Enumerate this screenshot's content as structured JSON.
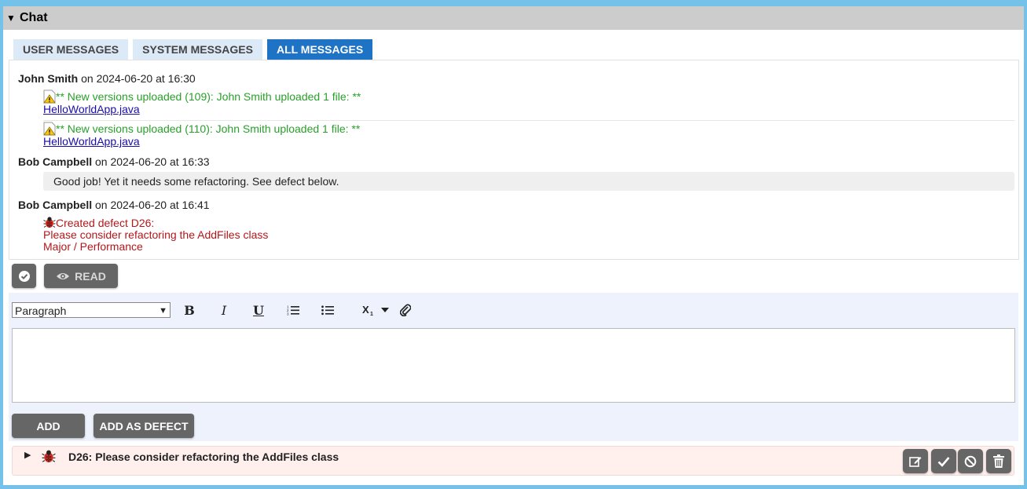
{
  "panel": {
    "title": "Chat"
  },
  "tabs": [
    {
      "label": "USER MESSAGES",
      "active": false
    },
    {
      "label": "SYSTEM MESSAGES",
      "active": false
    },
    {
      "label": "ALL MESSAGES",
      "active": true
    }
  ],
  "messages": [
    {
      "author": "John Smith",
      "meta": " on 2024-06-20 at 16:30",
      "system_entries": [
        {
          "icon": "warning-icon",
          "text": "** New versions uploaded (109): John Smith uploaded 1 file: **",
          "link": "HelloWorldApp.java"
        },
        {
          "icon": "warning-icon",
          "text": "** New versions uploaded (110): John Smith uploaded 1 file: **",
          "link": "HelloWorldApp.java"
        }
      ]
    },
    {
      "author": "Bob Campbell",
      "meta": " on 2024-06-20 at 16:33",
      "text": "Good job! Yet it needs some refactoring. See defect below."
    },
    {
      "author": "Bob Campbell",
      "meta": " on 2024-06-20 at 16:41",
      "defect_lines": [
        "Created defect D26:",
        "Please consider refactoring the AddFiles class",
        "Major / Performance"
      ]
    }
  ],
  "read_controls": {
    "read_label": "READ"
  },
  "editor": {
    "format_value": "Paragraph",
    "toolbar_buttons": [
      "bold-icon",
      "italic-icon",
      "underline-icon",
      "ordered-list-icon",
      "bullet-list-icon",
      "subscript-icon",
      "attach-icon"
    ],
    "content": ""
  },
  "actions": {
    "add_label": "ADD",
    "add_defect_label": "ADD AS DEFECT"
  },
  "defect_row": {
    "title": "D26: Please consider refactoring the AddFiles class"
  },
  "colors": {
    "accent": "#1f73c5",
    "tab_inactive": "#dce9f7",
    "system_text": "#28a02a",
    "defect_text": "#b3171b",
    "button": "#666666",
    "defect_row_bg": "#fff0ee"
  }
}
